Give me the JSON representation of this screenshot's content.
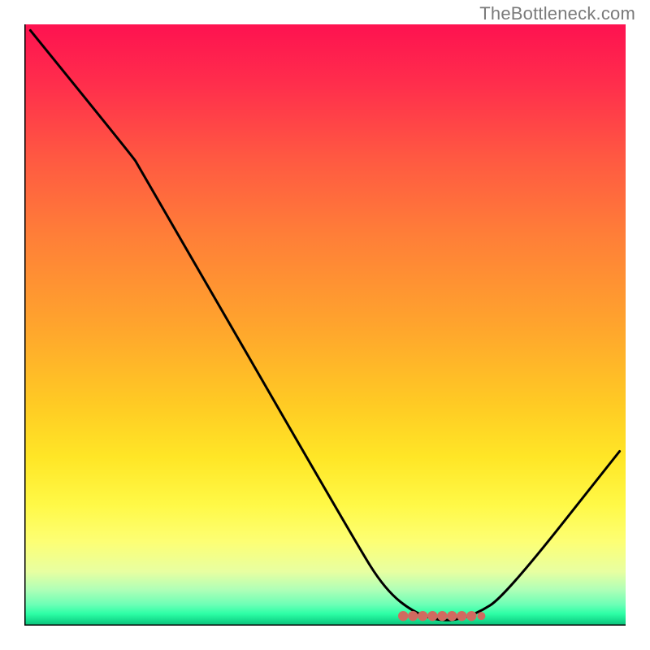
{
  "attribution": "TheBottleneck.com",
  "chart_data": {
    "type": "line",
    "title": "",
    "xlabel": "",
    "ylabel": "",
    "xlim": [
      0,
      100
    ],
    "ylim": [
      0,
      100
    ],
    "curve_points": [
      {
        "x": 1,
        "y": 99
      },
      {
        "x": 18,
        "y": 78
      },
      {
        "x": 19,
        "y": 76.5
      },
      {
        "x": 55,
        "y": 14
      },
      {
        "x": 60,
        "y": 6
      },
      {
        "x": 65,
        "y": 2
      },
      {
        "x": 70,
        "y": 0.6
      },
      {
        "x": 75,
        "y": 1.8
      },
      {
        "x": 80,
        "y": 5
      },
      {
        "x": 99,
        "y": 29
      }
    ],
    "marker_cluster": {
      "y": 1.6,
      "x_start": 63,
      "x_end": 76,
      "count": 9,
      "color": "#d16a60"
    },
    "gradient_stops": [
      {
        "pct": 0,
        "color": "#fe1250"
      },
      {
        "pct": 50,
        "color": "#ffa42d"
      },
      {
        "pct": 85,
        "color": "#fdff74"
      },
      {
        "pct": 100,
        "color": "#0dba77"
      }
    ]
  }
}
